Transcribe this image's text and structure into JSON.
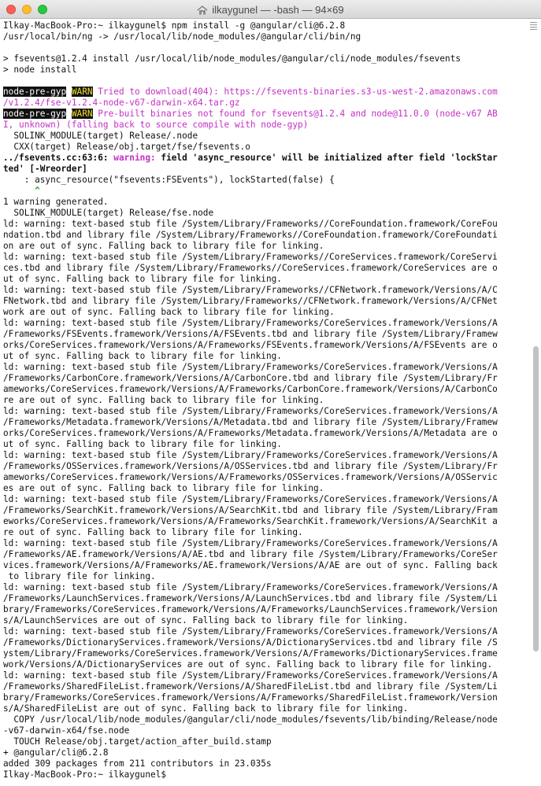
{
  "window": {
    "title": "ilkaygunel — -bash — 94×69"
  },
  "terminal": {
    "lines": [
      "Ilkay-MacBook-Pro:~ ilkaygunel$ npm install -g @angular/cli@6.2.8",
      "/usr/local/bin/ng -> /usr/local/lib/node_modules/@angular/cli/bin/ng",
      "",
      "> fsevents@1.2.4 install /usr/local/lib/node_modules/@angular/cli/node_modules/fsevents",
      "> node install",
      "",
      {
        "segments": [
          {
            "t": "node-pre-gyp",
            "c": "npg"
          },
          {
            "t": " "
          },
          {
            "t": "WARN",
            "c": "warn"
          },
          {
            "t": " Tried to download(404): https://fsevents-binaries.s3-us-west-2.amazonaws.com",
            "c": "pink"
          }
        ]
      },
      {
        "segments": [
          {
            "t": "/v1.2.4/fse-v1.2.4-node-v67-darwin-x64.tar.gz",
            "c": "pink"
          }
        ]
      },
      {
        "segments": [
          {
            "t": "node-pre-gyp",
            "c": "npg"
          },
          {
            "t": " "
          },
          {
            "t": "WARN",
            "c": "warn"
          },
          {
            "t": " Pre-built binaries not found for fsevents@1.2.4 and node@11.0.0 (node-v67 AB",
            "c": "pink"
          }
        ]
      },
      {
        "segments": [
          {
            "t": "I, unknown) (falling back to source compile with node-gyp)",
            "c": "pink"
          }
        ]
      },
      "  SOLINK_MODULE(target) Release/.node",
      "  CXX(target) Release/obj.target/fse/fsevents.o",
      {
        "segments": [
          {
            "t": "../fsevents.cc:63:6: ",
            "c": "bold"
          },
          {
            "t": "warning: ",
            "c": "pink bold"
          },
          {
            "t": "field 'async_resource' will be initialized after field 'lockStar",
            "c": "bold"
          }
        ]
      },
      {
        "segments": [
          {
            "t": "ted' [-Wreorder]",
            "c": "bold"
          }
        ]
      },
      "    : async_resource(\"fsevents:FSEvents\"), lockStarted(false) {",
      {
        "segments": [
          {
            "t": "      ^",
            "c": "green"
          }
        ]
      },
      "1 warning generated.",
      "  SOLINK_MODULE(target) Release/fse.node",
      "ld: warning: text-based stub file /System/Library/Frameworks//CoreFoundation.framework/CoreFou",
      "ndation.tbd and library file /System/Library/Frameworks//CoreFoundation.framework/CoreFoundati",
      "on are out of sync. Falling back to library file for linking.",
      "ld: warning: text-based stub file /System/Library/Frameworks//CoreServices.framework/CoreServi",
      "ces.tbd and library file /System/Library/Frameworks//CoreServices.framework/CoreServices are o",
      "ut of sync. Falling back to library file for linking.",
      "ld: warning: text-based stub file /System/Library/Frameworks//CFNetwork.framework/Versions/A/C",
      "FNetwork.tbd and library file /System/Library/Frameworks//CFNetwork.framework/Versions/A/CFNet",
      "work are out of sync. Falling back to library file for linking.",
      "ld: warning: text-based stub file /System/Library/Frameworks/CoreServices.framework/Versions/A",
      "/Frameworks/FSEvents.framework/Versions/A/FSEvents.tbd and library file /System/Library/Framew",
      "orks/CoreServices.framework/Versions/A/Frameworks/FSEvents.framework/Versions/A/FSEvents are o",
      "ut of sync. Falling back to library file for linking.",
      "ld: warning: text-based stub file /System/Library/Frameworks/CoreServices.framework/Versions/A",
      "/Frameworks/CarbonCore.framework/Versions/A/CarbonCore.tbd and library file /System/Library/Fr",
      "ameworks/CoreServices.framework/Versions/A/Frameworks/CarbonCore.framework/Versions/A/CarbonCo",
      "re are out of sync. Falling back to library file for linking.",
      "ld: warning: text-based stub file /System/Library/Frameworks/CoreServices.framework/Versions/A",
      "/Frameworks/Metadata.framework/Versions/A/Metadata.tbd and library file /System/Library/Framew",
      "orks/CoreServices.framework/Versions/A/Frameworks/Metadata.framework/Versions/A/Metadata are o",
      "ut of sync. Falling back to library file for linking.",
      "ld: warning: text-based stub file /System/Library/Frameworks/CoreServices.framework/Versions/A",
      "/Frameworks/OSServices.framework/Versions/A/OSServices.tbd and library file /System/Library/Fr",
      "ameworks/CoreServices.framework/Versions/A/Frameworks/OSServices.framework/Versions/A/OSServic",
      "es are out of sync. Falling back to library file for linking.",
      "ld: warning: text-based stub file /System/Library/Frameworks/CoreServices.framework/Versions/A",
      "/Frameworks/SearchKit.framework/Versions/A/SearchKit.tbd and library file /System/Library/Fram",
      "eworks/CoreServices.framework/Versions/A/Frameworks/SearchKit.framework/Versions/A/SearchKit a",
      "re out of sync. Falling back to library file for linking.",
      "ld: warning: text-based stub file /System/Library/Frameworks/CoreServices.framework/Versions/A",
      "/Frameworks/AE.framework/Versions/A/AE.tbd and library file /System/Library/Frameworks/CoreSer",
      "vices.framework/Versions/A/Frameworks/AE.framework/Versions/A/AE are out of sync. Falling back",
      " to library file for linking.",
      "ld: warning: text-based stub file /System/Library/Frameworks/CoreServices.framework/Versions/A",
      "/Frameworks/LaunchServices.framework/Versions/A/LaunchServices.tbd and library file /System/Li",
      "brary/Frameworks/CoreServices.framework/Versions/A/Frameworks/LaunchServices.framework/Version",
      "s/A/LaunchServices are out of sync. Falling back to library file for linking.",
      "ld: warning: text-based stub file /System/Library/Frameworks/CoreServices.framework/Versions/A",
      "/Frameworks/DictionaryServices.framework/Versions/A/DictionaryServices.tbd and library file /S",
      "ystem/Library/Frameworks/CoreServices.framework/Versions/A/Frameworks/DictionaryServices.frame",
      "work/Versions/A/DictionaryServices are out of sync. Falling back to library file for linking.",
      "ld: warning: text-based stub file /System/Library/Frameworks/CoreServices.framework/Versions/A",
      "/Frameworks/SharedFileList.framework/Versions/A/SharedFileList.tbd and library file /System/Li",
      "brary/Frameworks/CoreServices.framework/Versions/A/Frameworks/SharedFileList.framework/Version",
      "s/A/SharedFileList are out of sync. Falling back to library file for linking.",
      "  COPY /usr/local/lib/node_modules/@angular/cli/node_modules/fsevents/lib/binding/Release/node",
      "-v67-darwin-x64/fse.node",
      "  TOUCH Release/obj.target/action_after_build.stamp",
      "+ @angular/cli@6.2.8",
      "added 309 packages from 211 contributors in 23.035s",
      "Ilkay-MacBook-Pro:~ ilkaygunel$ "
    ]
  }
}
